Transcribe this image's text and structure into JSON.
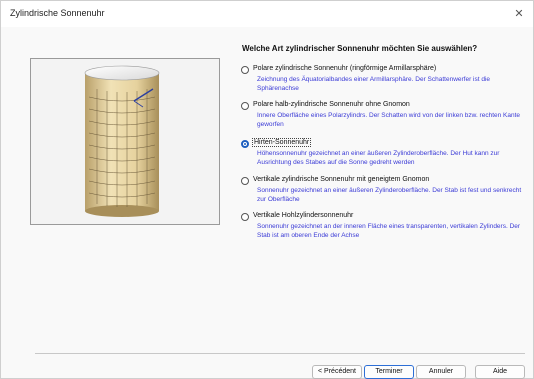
{
  "window": {
    "title": "Zylindrische Sonnenuhr",
    "close_icon": "close-icon"
  },
  "question": "Welche Art zylindrischer Sonnenuhr möchten Sie auswählen?",
  "options": [
    {
      "label": "Polare zylindrische Sonnenuhr (ringförmige Armillarsphäre)",
      "description": "Zeichnung des Äquatorialbandes einer Armillarsphäre. Der Schattenwerfer ist die Sphärenachse",
      "selected": false
    },
    {
      "label": "Polare halb-zylindrische Sonnenuhr ohne Gnomon",
      "description": "Innere Oberfläche eines Polarzylindrs. Der Schatten wird von der linken bzw. rechten Kante geworfen",
      "selected": false
    },
    {
      "label": "Hirten-Sonnenuhr",
      "description": "Höhensonnenuhr gezeichnet an einer äußeren Zylinderoberfläche. Der Hut kann zur Ausrichtung des Stabes auf die Sonne gedreht werden",
      "selected": true
    },
    {
      "label": "Vertikale zylindrische Sonnenuhr mit geneigtem Gnomon",
      "description": "Sonnenuhr gezeichnet an einer äußeren Zylinderoberfläche. Der Stab ist fest und senkrecht zur Oberfläche",
      "selected": false
    },
    {
      "label": "Vertikale Hohlzylindersonnenuhr",
      "description": "Sonnenuhr gezeichnet an der inneren Fläche eines transparenten, vertikalen Zylinders. Der Stab ist am oberen Ende der Achse",
      "selected": false
    }
  ],
  "buttons": {
    "previous": "< Précédent",
    "finish": "Terminer",
    "cancel": "Annuler",
    "help": "Aide"
  },
  "colors": {
    "accent": "#1f5fbf",
    "description_text": "#3b3bd6",
    "cylinder_body": "#e8d6a3"
  }
}
